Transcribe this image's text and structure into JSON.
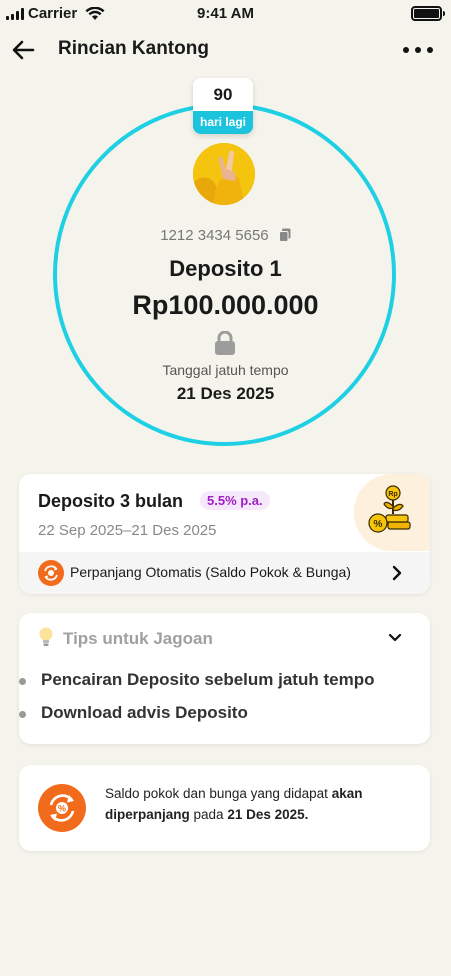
{
  "status_bar": {
    "carrier": "Carrier",
    "time": "9:41 AM"
  },
  "header": {
    "title": "Rincian Kantong"
  },
  "hero": {
    "days_remaining": "90",
    "days_label": "hari lagi",
    "account_number": "1212 3434 5656",
    "pocket_name": "Deposito 1",
    "amount": "Rp100.000.000",
    "due_label": "Tanggal jatuh tempo",
    "due_date": "21 Des 2025"
  },
  "product": {
    "title": "Deposito 3 bulan",
    "rate": "5.5% p.a.",
    "period": "22 Sep 2025–21 Des 2025",
    "renewal_label": "Perpanjang Otomatis (Saldo Pokok & Bunga)"
  },
  "tips": {
    "title": "Tips untuk Jagoan",
    "items": [
      "Pencairan Deposito sebelum jatuh tempo",
      "Download advis Deposito"
    ]
  },
  "info": {
    "part1": "Saldo pokok dan bunga yang didapat ",
    "part2": "akan diperpanjang",
    "part3": " pada ",
    "part4": "21 Des 2025."
  },
  "colors": {
    "accent_cyan": "#1fd0e4",
    "badge_cyan": "#1cc3dd",
    "orange": "#f26a1b",
    "rate_purple": "#a020c4",
    "background": "#f5f4ec"
  },
  "icons": [
    "signal-icon",
    "wifi-icon",
    "battery-icon",
    "back-arrow-icon",
    "more-icon",
    "copy-icon",
    "lock-icon",
    "renew-icon",
    "chevron-right-icon",
    "bulb-icon",
    "chevron-down-icon",
    "deposit-growth-icon"
  ]
}
